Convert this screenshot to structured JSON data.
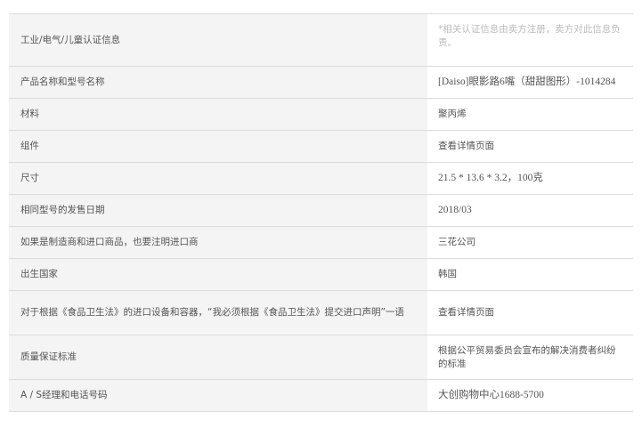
{
  "rows": [
    {
      "label": "工业/电气/儿童认证信息",
      "value": "*相关认证信息由卖方注册，卖方对此信息负责。"
    },
    {
      "label": "产品名称和型号名称",
      "value": "[Daiso]眼影路6嘴（甜甜图形）-1014284"
    },
    {
      "label": "材料",
      "value": "聚丙烯"
    },
    {
      "label": "组件",
      "value": "查看详情页面"
    },
    {
      "label": "尺寸",
      "value": "21.5 * 13.6 * 3.2，100克"
    },
    {
      "label": "相同型号的发售日期",
      "value": "2018/03"
    },
    {
      "label": "如果是制造商和进口商品，也要注明进口商",
      "value": "三花公司"
    },
    {
      "label": "出生国家",
      "value": "韩国"
    },
    {
      "label": "对于根据《食品卫生法》的进口设备和容器，“我必须根据《食品卫生法》提交进口声明”一语",
      "value": "查看详情页面"
    },
    {
      "label": "质量保证标准",
      "value": "根据公平贸易委员会宣布的解决消费者纠纷的标准"
    },
    {
      "label": "A / S经理和电话号码",
      "value": "大创购物中心1688-5700"
    }
  ]
}
